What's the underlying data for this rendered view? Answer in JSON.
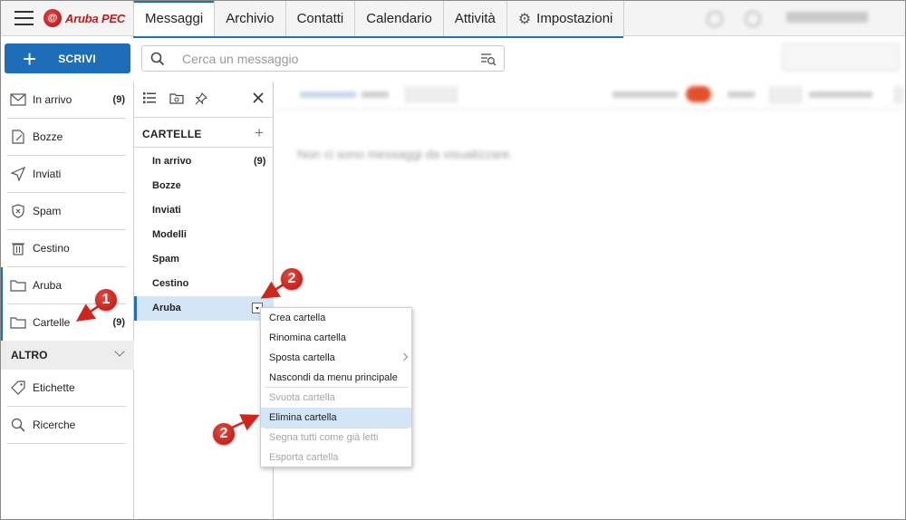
{
  "header": {
    "logo_text": "Aruba PEC",
    "tabs": [
      "Messaggi",
      "Archivio",
      "Contatti",
      "Calendario",
      "Attività",
      "Impostazioni"
    ],
    "active_tab": "Messaggi",
    "accent": "#1f6fc0",
    "brand": "#c51f1f"
  },
  "toolbar": {
    "compose_label": "SCRIVI",
    "search_placeholder": "Cerca un messaggio"
  },
  "sidebar": {
    "items": [
      {
        "label": "In arrivo",
        "count": "(9)",
        "icon": "inbox-icon"
      },
      {
        "label": "Bozze",
        "count": "",
        "icon": "draft-icon"
      },
      {
        "label": "Inviati",
        "count": "",
        "icon": "send-icon"
      },
      {
        "label": "Spam",
        "count": "",
        "icon": "spam-icon"
      },
      {
        "label": "Cestino",
        "count": "",
        "icon": "trash-icon"
      },
      {
        "label": "Aruba",
        "count": "",
        "icon": "folder-icon"
      },
      {
        "label": "Cartelle",
        "count": "(9)",
        "icon": "folder-icon"
      }
    ],
    "section_label": "ALTRO",
    "extra_items": [
      {
        "label": "Etichette",
        "icon": "tag-icon"
      },
      {
        "label": "Ricerche",
        "icon": "search-icon"
      }
    ]
  },
  "folders": {
    "heading": "CARTELLE",
    "items": [
      {
        "label": "In arrivo",
        "count": "(9)"
      },
      {
        "label": "Bozze",
        "count": ""
      },
      {
        "label": "Inviati",
        "count": ""
      },
      {
        "label": "Modelli",
        "count": ""
      },
      {
        "label": "Spam",
        "count": ""
      },
      {
        "label": "Cestino",
        "count": ""
      }
    ],
    "selected": "Aruba"
  },
  "main": {
    "empty_text": "Non ci sono messaggi da visualizzare."
  },
  "context_menu": {
    "items": [
      {
        "label": "Crea cartella",
        "disabled": false
      },
      {
        "label": "Rinomina cartella",
        "disabled": false
      },
      {
        "label": "Sposta cartella",
        "disabled": false,
        "submenu": true
      },
      {
        "label": "Nascondi da menu principale",
        "disabled": false
      },
      {
        "label": "Svuota cartella",
        "disabled": true
      },
      {
        "label": "Elimina cartella",
        "disabled": false,
        "highlighted": true
      },
      {
        "label": "Segna tutti come già letti",
        "disabled": true
      },
      {
        "label": "Esporta cartella",
        "disabled": true
      }
    ]
  },
  "annotations": {
    "badge1": "1",
    "badge2": "2",
    "color": "#d0251d"
  }
}
